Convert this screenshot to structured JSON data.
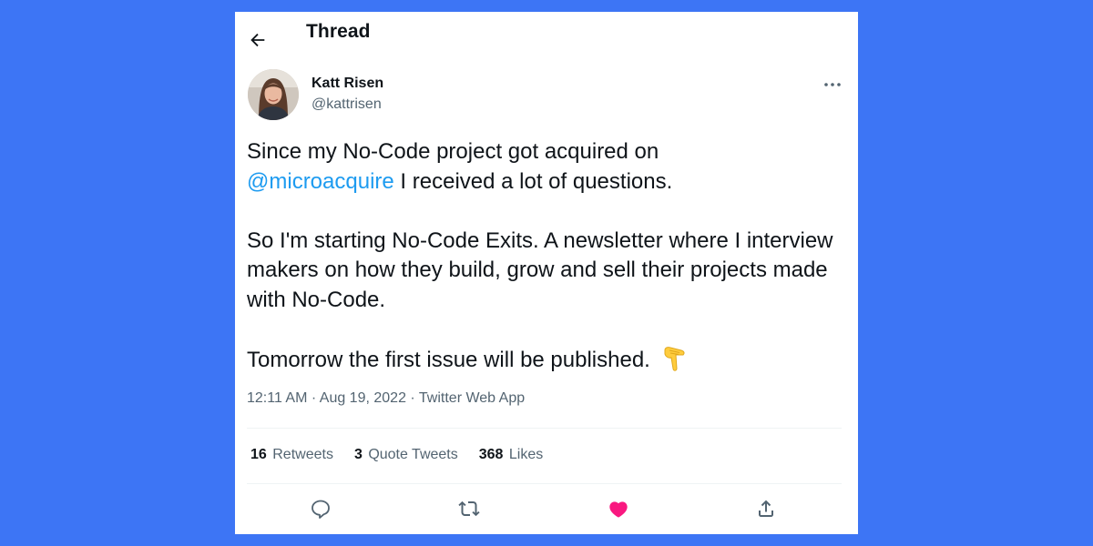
{
  "header": {
    "title": "Thread"
  },
  "author": {
    "name": "Katt Risen",
    "handle": "@kattrisen"
  },
  "tweet": {
    "line1_before": "Since my No-Code project got acquired on",
    "mention": "@microacquire",
    "line1_after": " I received a lot of questions.",
    "paragraph2": "So I'm starting No-Code Exits. A newsletter where I interview makers on how they build, grow and sell their projects made with No-Code.",
    "paragraph3": "Tomorrow the first issue will be published.",
    "emoji": "backhand-index-pointing-down"
  },
  "meta": {
    "time": "12:11 AM",
    "separator": "·",
    "date": "Aug 19, 2022",
    "source": "Twitter Web App"
  },
  "stats": {
    "retweets_count": "16",
    "retweets_label": "Retweets",
    "quotes_count": "3",
    "quotes_label": "Quote Tweets",
    "likes_count": "368",
    "likes_label": "Likes"
  },
  "colors": {
    "background": "#3d75f5",
    "link": "#1d9bf0",
    "like": "#f91880",
    "secondary_text": "#536471"
  },
  "icons": {
    "back": "arrow-left-icon",
    "more": "more-dots-icon",
    "reply": "reply-icon",
    "retweet": "retweet-icon",
    "like": "heart-filled-icon",
    "share": "share-icon"
  }
}
